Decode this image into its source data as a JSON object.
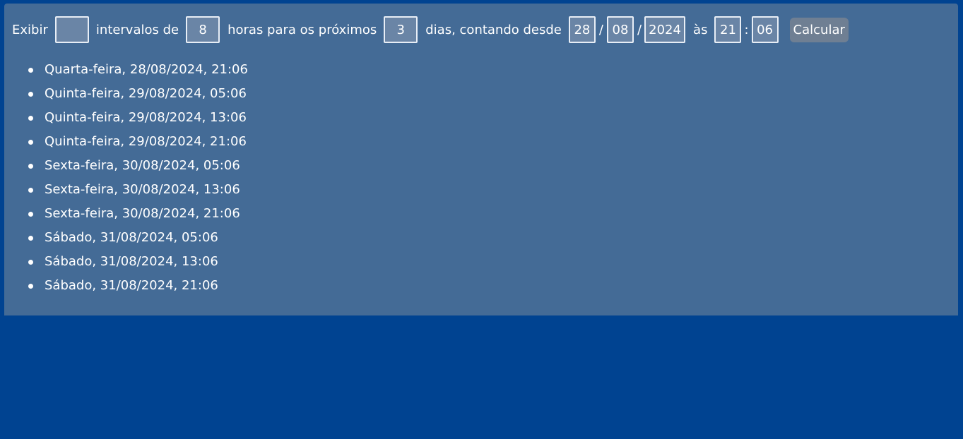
{
  "form": {
    "label_show": "Exibir",
    "count_value": "",
    "label_intervals": "intervalos de",
    "hours_value": "8",
    "label_hours_next": "horas para os próximos",
    "days_value": "3",
    "label_days_since": "dias, contando desde",
    "day_value": "28",
    "sep_1": "/",
    "month_value": "08",
    "sep_2": "/",
    "year_value": "2024",
    "label_at": "às",
    "hour_value": "21",
    "time_sep": ":",
    "minute_value": "06",
    "calculate_label": "Calcular"
  },
  "results": [
    "Quarta-feira, 28/08/2024, 21:06",
    "Quinta-feira, 29/08/2024, 05:06",
    "Quinta-feira, 29/08/2024, 13:06",
    "Quinta-feira, 29/08/2024, 21:06",
    "Sexta-feira, 30/08/2024, 05:06",
    "Sexta-feira, 30/08/2024, 13:06",
    "Sexta-feira, 30/08/2024, 21:06",
    "Sábado, 31/08/2024, 05:06",
    "Sábado, 31/08/2024, 13:06",
    "Sábado, 31/08/2024, 21:06"
  ]
}
